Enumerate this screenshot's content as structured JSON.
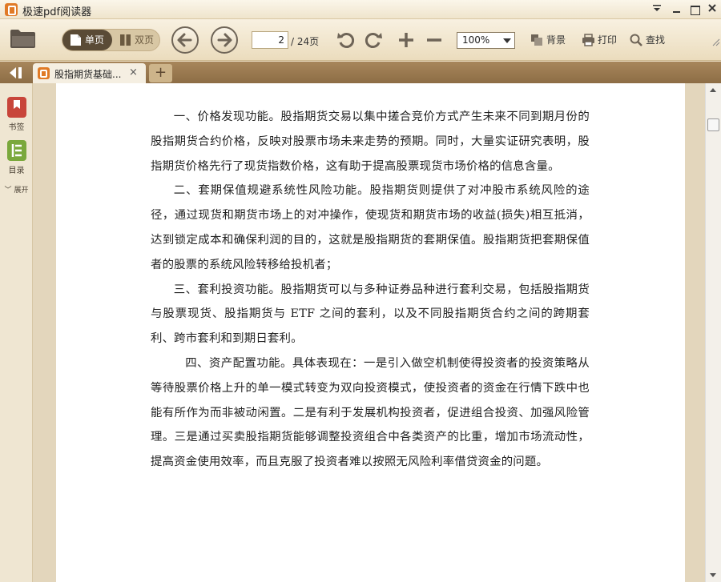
{
  "window": {
    "title": "极速pdf阅读器"
  },
  "toolbar": {
    "view_single": "单页",
    "view_double": "双页",
    "page_current": "2",
    "page_total": "/ 24页",
    "zoom": "100%",
    "background_label": "背景",
    "print_label": "打印",
    "find_label": "查找"
  },
  "tabs": {
    "doc_tab_label": "股指期货基础...",
    "doc_tab_close": "×",
    "new_tab": "+"
  },
  "sidebar": {
    "bookmark_label": "书签",
    "toc_label": "目录",
    "expand_label": "展开"
  },
  "document": {
    "paragraphs": [
      "一、价格发现功能。股指期货交易以集中搓合竞价方式产生未来不同到期月份的股指期货合约价格，反映对股票市场未来走势的预期。同时，大量实证研究表明，股指期货价格先行了现货指数价格，这有助于提高股票现货市场价格的信息含量。",
      "二、套期保值规避系统性风险功能。股指期货则提供了对冲股市系统风险的途径，通过现货和期货市场上的对冲操作，使现货和期货市场的收益(损失)相互抵消，达到锁定成本和确保利润的目的，这就是股指期货的套期保值。股指期货把套期保值者的股票的系统风险转移给投机者；",
      "三、套利投资功能。股指期货可以与多种证券品种进行套利交易，包括股指期货与股票现货、股指期货与 ETF 之间的套利，以及不同股指期货合约之间的跨期套利、跨市套利和到期日套利。",
      "四、资产配置功能。具体表现在：一是引入做空机制使得投资者的投资策略从等待股票价格上升的单一模式转变为双向投资模式，使投资者的资金在行情下跌中也能有所作为而非被动闲置。二是有利于发展机构投资者，促进组合投资、加强风险管理。三是通过买卖股指期货能够调整投资组合中各类资产的比重，增加市场流动性，提高资金使用效率，而且克服了投资者难以按照无风险利率借贷资金的问题。"
    ]
  }
}
